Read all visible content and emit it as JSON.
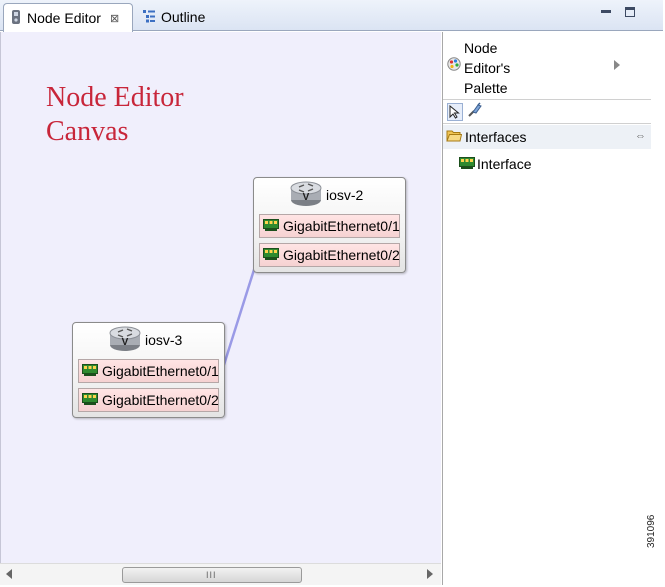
{
  "tabs": [
    {
      "label": "Node Editor",
      "active": true,
      "icon": "node-editor-icon"
    },
    {
      "label": "Outline",
      "active": false,
      "icon": "outline-icon"
    }
  ],
  "canvas": {
    "title": "Node Editor\nCanvas",
    "title_color": "#c8263a",
    "background": "#f0effc",
    "nodes": [
      {
        "name": "iosv-2",
        "interfaces": [
          "GigabitEthernet0/1",
          "GigabitEthernet0/2"
        ]
      },
      {
        "name": "iosv-3",
        "interfaces": [
          "GigabitEthernet0/1",
          "GigabitEthernet0/2"
        ]
      }
    ],
    "links": [
      {
        "from": "iosv-3 GigabitEthernet0/1",
        "to": "iosv-2 GigabitEthernet0/2",
        "color": "#9a9ae6"
      }
    ]
  },
  "palette": {
    "title": "Node\nEditor's\nPalette",
    "drawers": [
      {
        "label": "Interfaces",
        "entries": [
          "Interface"
        ]
      }
    ]
  },
  "figure_id": "391096"
}
